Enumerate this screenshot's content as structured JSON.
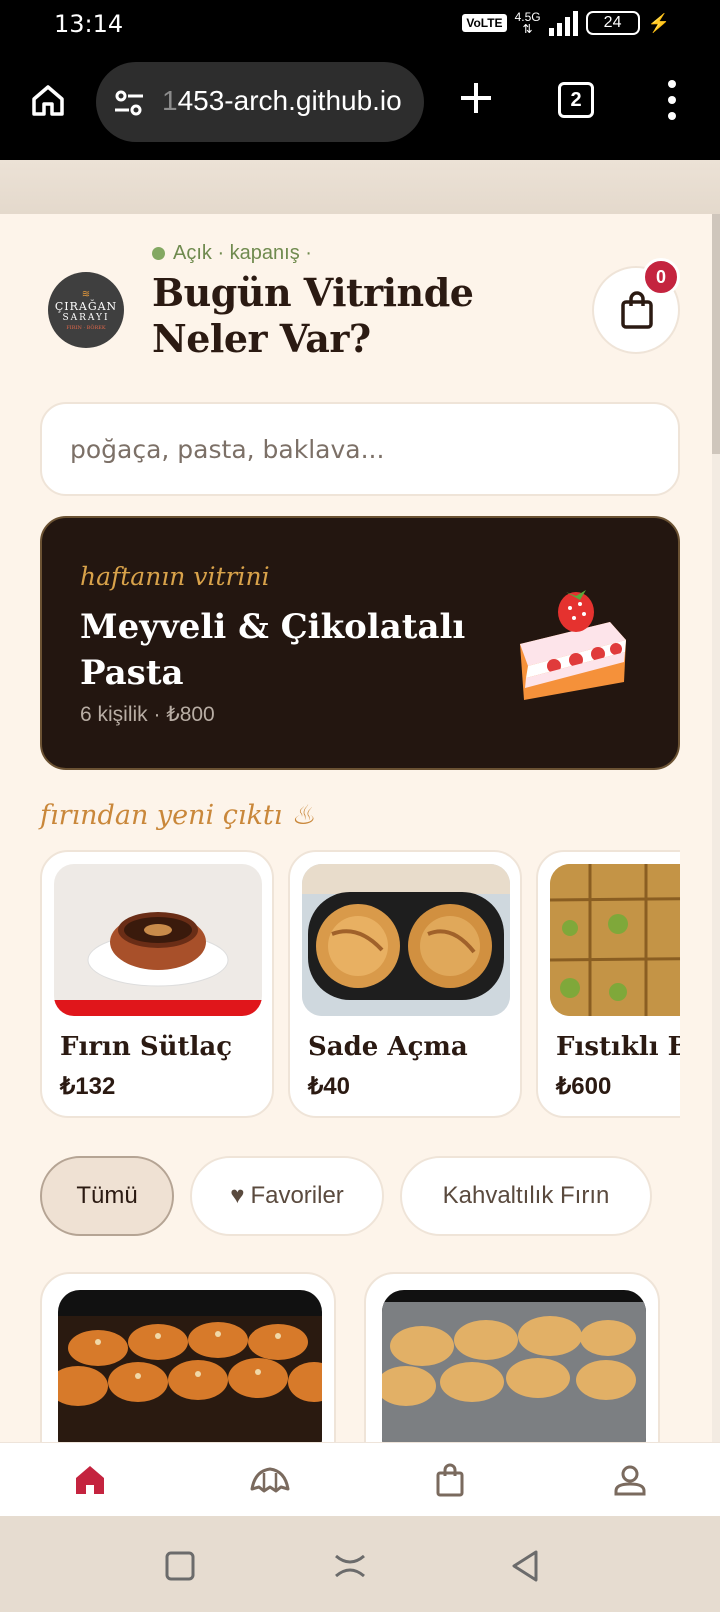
{
  "status_bar": {
    "time": "13:14",
    "volte": "VoLTE",
    "network": "4.5G",
    "battery": "24"
  },
  "browser": {
    "url_dim": "1",
    "url_rest": "453-arch.github.io",
    "tab_count": "2"
  },
  "header": {
    "status_text": "Açık · kapanış ·",
    "title": "Bugün Vitrinde Neler Var?",
    "cart_count": "0",
    "logo_line1": "ÇIRAĞAN",
    "logo_line2": "SARAYI",
    "logo_line3": "FIRIN · BÖREK"
  },
  "search": {
    "placeholder": "poğaça, pasta, baklava..."
  },
  "hero": {
    "kicker": "haftanın vitrini",
    "title": "Meyveli & Çikolatalı Pasta",
    "subtitle": "6 kişilik · ₺800"
  },
  "fresh": {
    "title": "fırından yeni çıktı ♨",
    "items": [
      {
        "name": "Fırın Sütlaç",
        "price": "₺132"
      },
      {
        "name": "Sade Açma",
        "price": "₺40"
      },
      {
        "name": "Fıstıklı Baklava",
        "price": "₺600"
      }
    ]
  },
  "filters": [
    {
      "label": "Tümü"
    },
    {
      "label": "Favoriler"
    },
    {
      "label": "Kahvaltılık Fırın"
    }
  ],
  "colors": {
    "accent": "#c4243f",
    "dark": "#231610",
    "gold": "#c9873a",
    "background": "#fdf4ea"
  }
}
